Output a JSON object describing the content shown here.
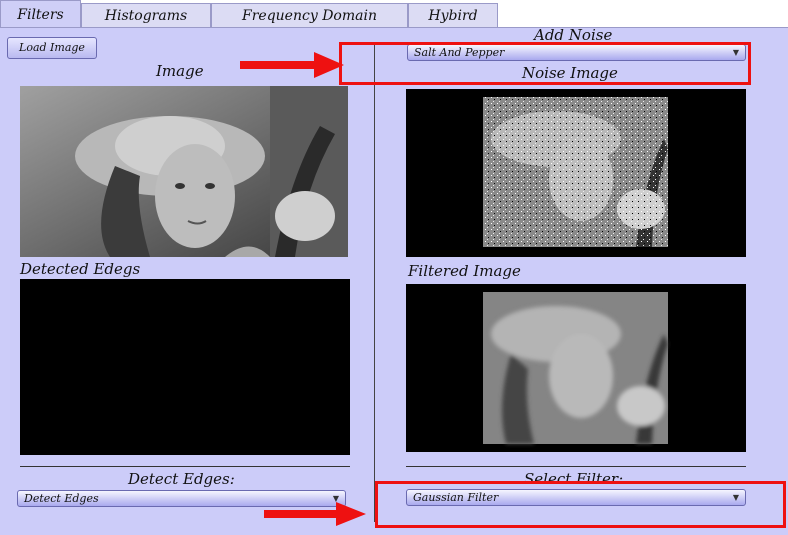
{
  "tabs": [
    {
      "label": "Filters"
    },
    {
      "label": "Histograms"
    },
    {
      "label": "Frequency Domain"
    },
    {
      "label": "Hybird"
    }
  ],
  "left": {
    "load_button": "Load Image",
    "image_label": "Image",
    "edges_label": "Detected Edegs",
    "detect_label": "Detect Edges:",
    "detect_combo": "Detect Edges"
  },
  "right": {
    "add_noise_label": "Add Noise",
    "noise_combo": "Salt And Pepper",
    "noise_image_label": "Noise Image",
    "filtered_label": "Filtered Image",
    "select_filter_label": "Select Filter:",
    "filter_combo": "Gaussian Filter"
  },
  "annotation_color": "#ee1111"
}
